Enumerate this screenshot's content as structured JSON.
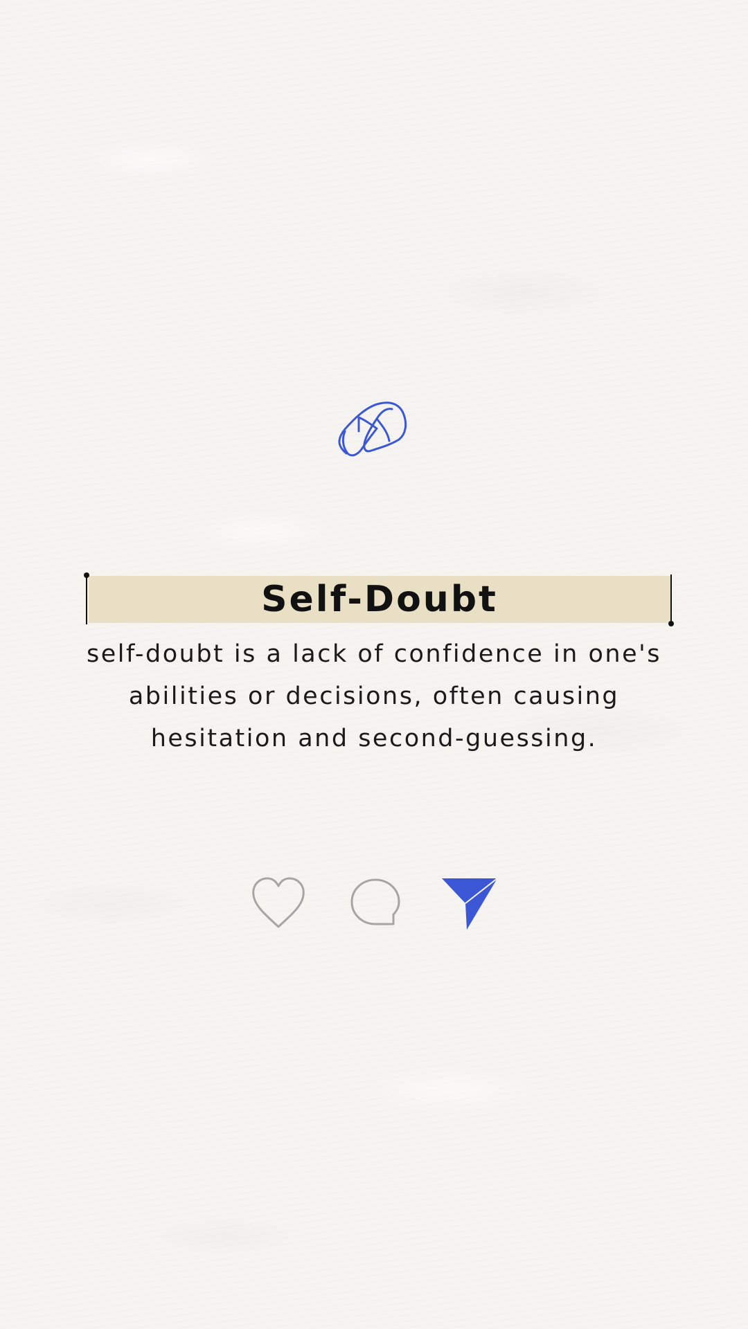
{
  "post": {
    "title": "Self-Doubt",
    "description": "self-doubt is a lack of confidence in one's abilities or decisions, often causing hesitation and second-guessing."
  },
  "icons": {
    "logo": "scribble-icon",
    "like": "heart-outline-icon",
    "comment": "speech-bubble-outline-icon",
    "share": "paper-plane-icon"
  },
  "colors": {
    "accent": "#3b57d6",
    "title_highlight": "#e9dfc4",
    "icon_outline": "#a5a5a5",
    "text": "#111111",
    "background": "#f6f4f1"
  }
}
